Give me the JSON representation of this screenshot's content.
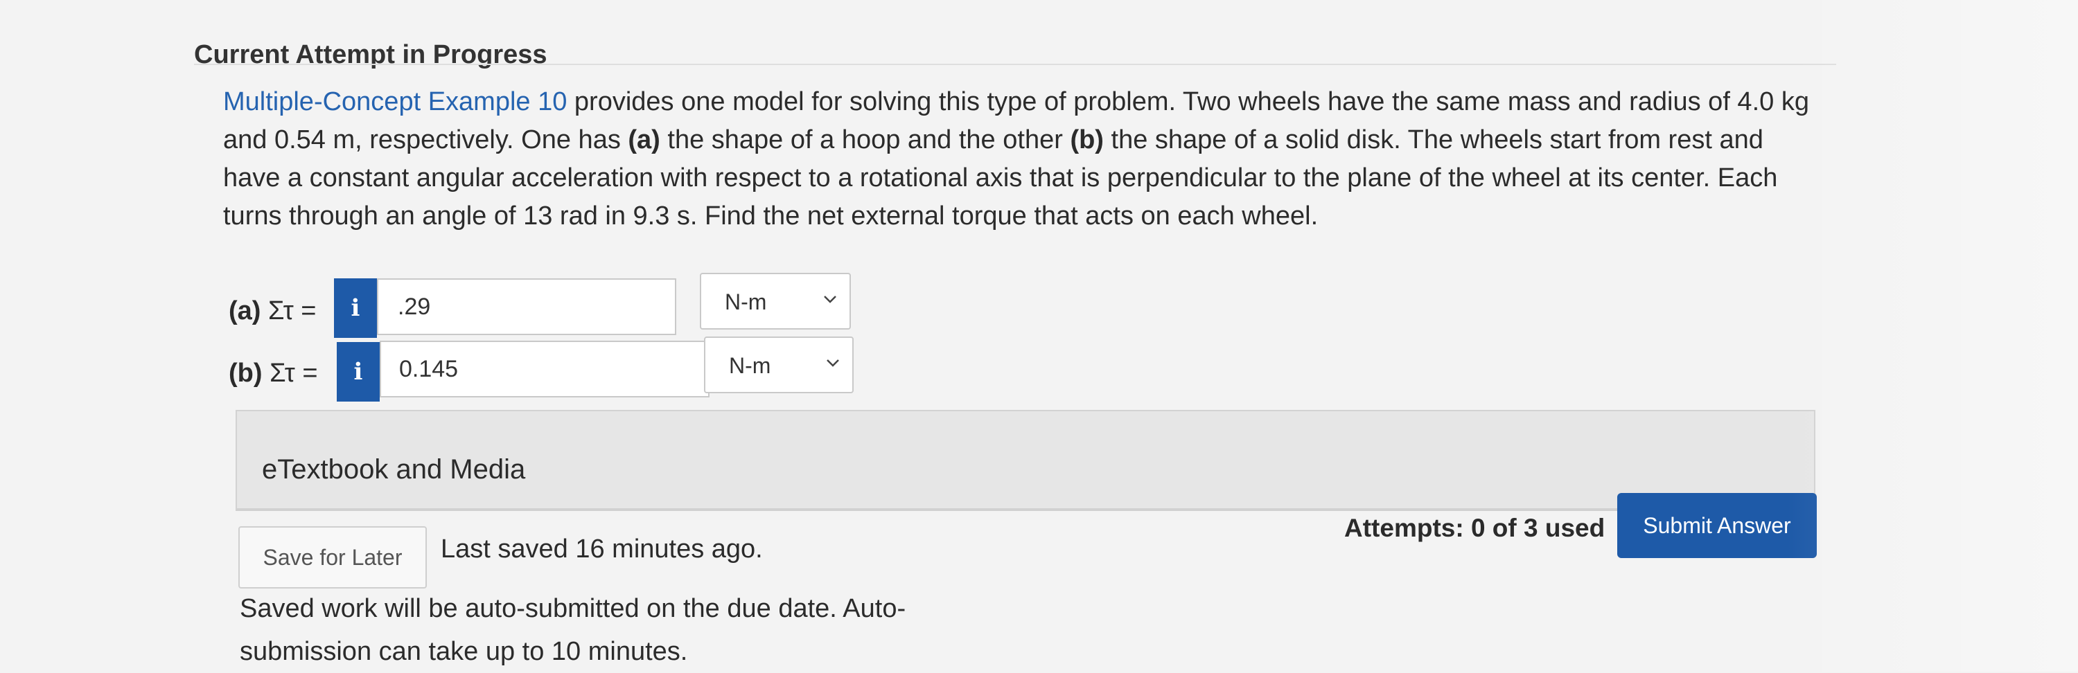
{
  "header": {
    "title": "Current Attempt in Progress"
  },
  "problem": {
    "link_text": "Multiple-Concept Example 10",
    "text_1": " provides one model for solving this type of problem. Two wheels have the same mass and radius of 4.0 kg and 0.54 m, respectively. One has ",
    "part_a_marker": "(a)",
    "text_2": " the shape of a hoop and the other ",
    "part_b_marker": "(b)",
    "text_3": " the shape of a solid disk. The wheels start from rest and have a constant angular acceleration with respect to a rotational axis that is perpendicular to the plane of the wheel at its center. Each turns through an angle of 13 rad in 9.3 s. Find the net external torque that acts on each wheel."
  },
  "answers": [
    {
      "part": "(a)",
      "label": "Στ =",
      "info_glyph": "i",
      "value": ".29",
      "unit": "N-m"
    },
    {
      "part": "(b)",
      "label": "Στ =",
      "info_glyph": "i",
      "value": "0.145",
      "unit": "N-m"
    }
  ],
  "media": {
    "title": "eTextbook and Media"
  },
  "footer": {
    "save_label": "Save for Later",
    "last_saved": "Last saved 16 minutes ago.",
    "attempts": "Attempts: 0 of 3 used",
    "submit_label": "Submit Answer",
    "note": "Saved work will be auto-submitted on the due date. Auto-submission can take up to 10 minutes."
  },
  "colors": {
    "accent": "#1e5aa8",
    "link": "#2563b0"
  },
  "icons": {
    "info": "info-icon",
    "dropdown": "chevron-down-icon"
  }
}
